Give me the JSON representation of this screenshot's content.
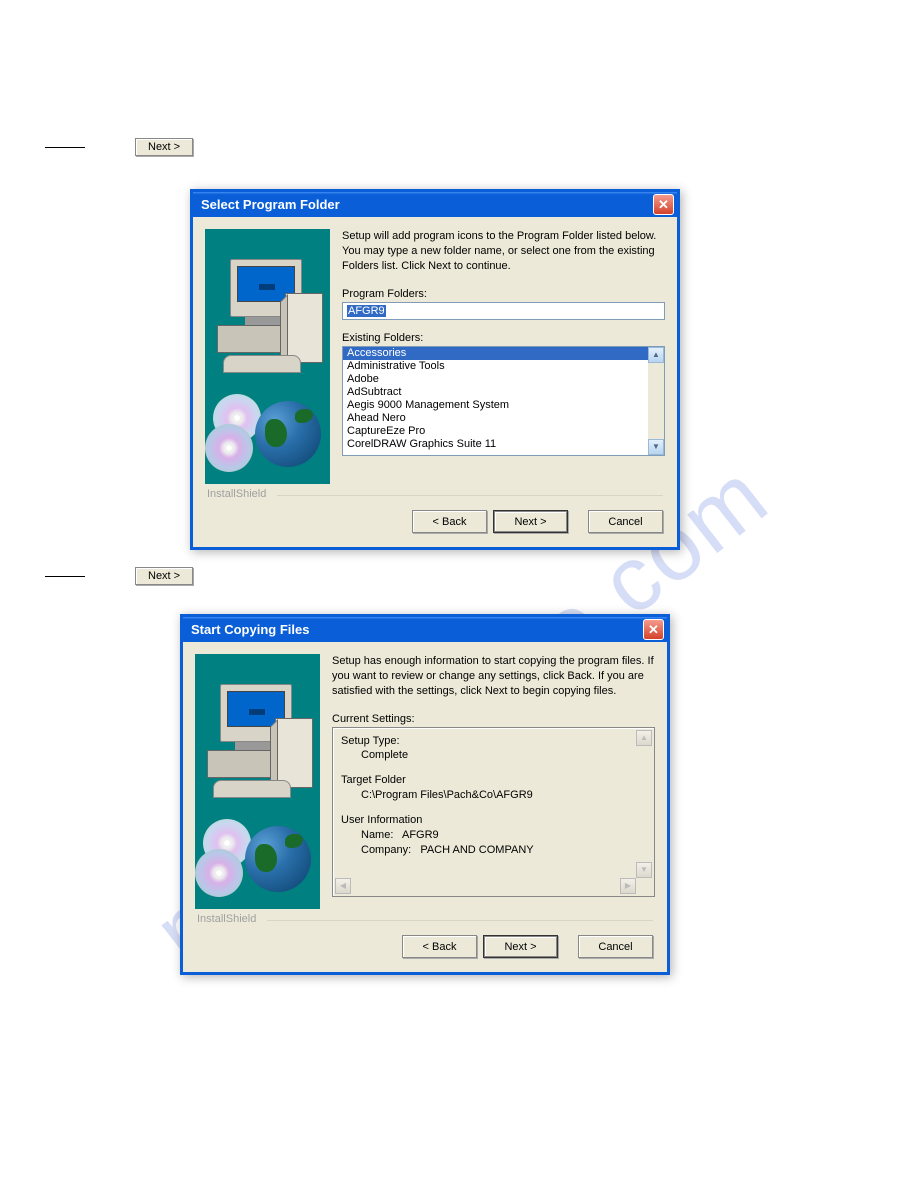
{
  "step1": {
    "next_label": "Next >"
  },
  "step2": {
    "next_label": "Next >"
  },
  "dialog1": {
    "title": "Select Program Folder",
    "instruction": "Setup will add program icons to the Program Folder listed below. You may type a new folder name, or select one from the existing Folders list.  Click Next to continue.",
    "program_folders_label": "Program Folders:",
    "program_folders_value": "AFGR9",
    "existing_folders_label": "Existing Folders:",
    "existing_folders": [
      "Accessories",
      "Administrative Tools",
      "Adobe",
      "AdSubtract",
      "Aegis 9000 Management System",
      "Ahead Nero",
      "CaptureEze Pro",
      "CorelDRAW Graphics Suite 11"
    ],
    "selected_index": 0,
    "brand": "InstallShield",
    "buttons": {
      "back": "< Back",
      "next": "Next >",
      "cancel": "Cancel"
    }
  },
  "dialog2": {
    "title": "Start Copying Files",
    "instruction": "Setup has enough information to start copying the program files. If you want to review or change any settings, click Back.  If you are satisfied with the settings, click Next to begin copying files.",
    "current_settings_label": "Current Settings:",
    "settings": {
      "setup_type_label": "Setup Type:",
      "setup_type_value": "Complete",
      "target_folder_label": "Target Folder",
      "target_folder_value": "C:\\Program Files\\Pach&Co\\AFGR9",
      "user_info_label": "User Information",
      "user_name_label": "Name:",
      "user_name_value": "AFGR9",
      "user_company_label": "Company:",
      "user_company_value": "PACH AND COMPANY"
    },
    "brand": "InstallShield",
    "buttons": {
      "back": "< Back",
      "next": "Next >",
      "cancel": "Cancel"
    }
  },
  "watermark_text": "manualshive.com"
}
